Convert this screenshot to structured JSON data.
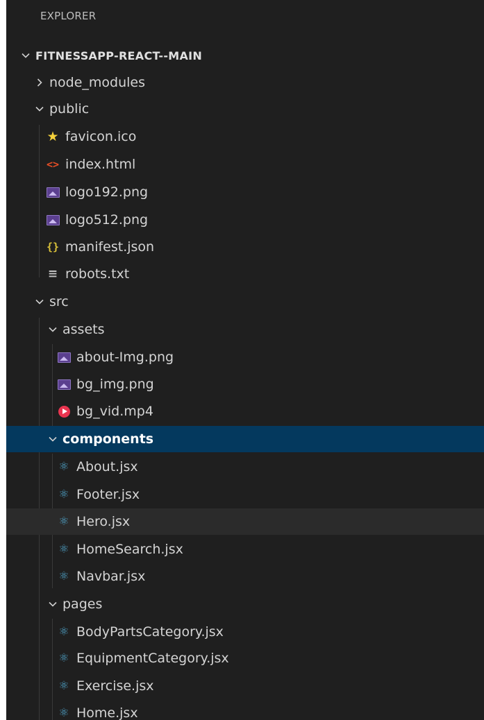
{
  "explorer": {
    "header": "EXPLORER",
    "root": {
      "label": "FITNESSAPP-REACT--MAIN",
      "expanded": true
    },
    "items": [
      {
        "label": "node_modules",
        "type": "folder",
        "expanded": false,
        "icon": "chevron-right"
      },
      {
        "label": "public",
        "type": "folder",
        "expanded": true,
        "icon": "chevron-down"
      },
      {
        "label": "favicon.ico",
        "type": "file",
        "icon": "star"
      },
      {
        "label": "index.html",
        "type": "file",
        "icon": "html-code"
      },
      {
        "label": "logo192.png",
        "type": "file",
        "icon": "image"
      },
      {
        "label": "logo512.png",
        "type": "file",
        "icon": "image"
      },
      {
        "label": "manifest.json",
        "type": "file",
        "icon": "json-braces"
      },
      {
        "label": "robots.txt",
        "type": "file",
        "icon": "text-lines"
      },
      {
        "label": "src",
        "type": "folder",
        "expanded": true,
        "icon": "chevron-down"
      },
      {
        "label": "assets",
        "type": "folder",
        "expanded": true,
        "icon": "chevron-down"
      },
      {
        "label": "about-Img.png",
        "type": "file",
        "icon": "image"
      },
      {
        "label": "bg_img.png",
        "type": "file",
        "icon": "image"
      },
      {
        "label": "bg_vid.mp4",
        "type": "file",
        "icon": "video"
      },
      {
        "label": "components",
        "type": "folder",
        "expanded": true,
        "selected": true,
        "icon": "chevron-down"
      },
      {
        "label": "About.jsx",
        "type": "file",
        "icon": "react"
      },
      {
        "label": "Footer.jsx",
        "type": "file",
        "icon": "react"
      },
      {
        "label": "Hero.jsx",
        "type": "file",
        "icon": "react",
        "hovered": true
      },
      {
        "label": "HomeSearch.jsx",
        "type": "file",
        "icon": "react"
      },
      {
        "label": "Navbar.jsx",
        "type": "file",
        "icon": "react"
      },
      {
        "label": "pages",
        "type": "folder",
        "expanded": true,
        "icon": "chevron-down"
      },
      {
        "label": "BodyPartsCategory.jsx",
        "type": "file",
        "icon": "react"
      },
      {
        "label": "EquipmentCategory.jsx",
        "type": "file",
        "icon": "react"
      },
      {
        "label": "Exercise.jsx",
        "type": "file",
        "icon": "react"
      },
      {
        "label": "Home.jsx",
        "type": "file",
        "icon": "react"
      }
    ]
  },
  "colors": {
    "background": "#1f1f1f",
    "selected_row": "#04395e",
    "hover_row": "#2b2b2b",
    "react_icon": "#4fa2c7",
    "image_icon": "#5b3f8f",
    "star_icon": "#f5d13b",
    "html_icon": "#e44d26",
    "json_icon": "#d9c13a",
    "video_icon": "#e8344f"
  }
}
